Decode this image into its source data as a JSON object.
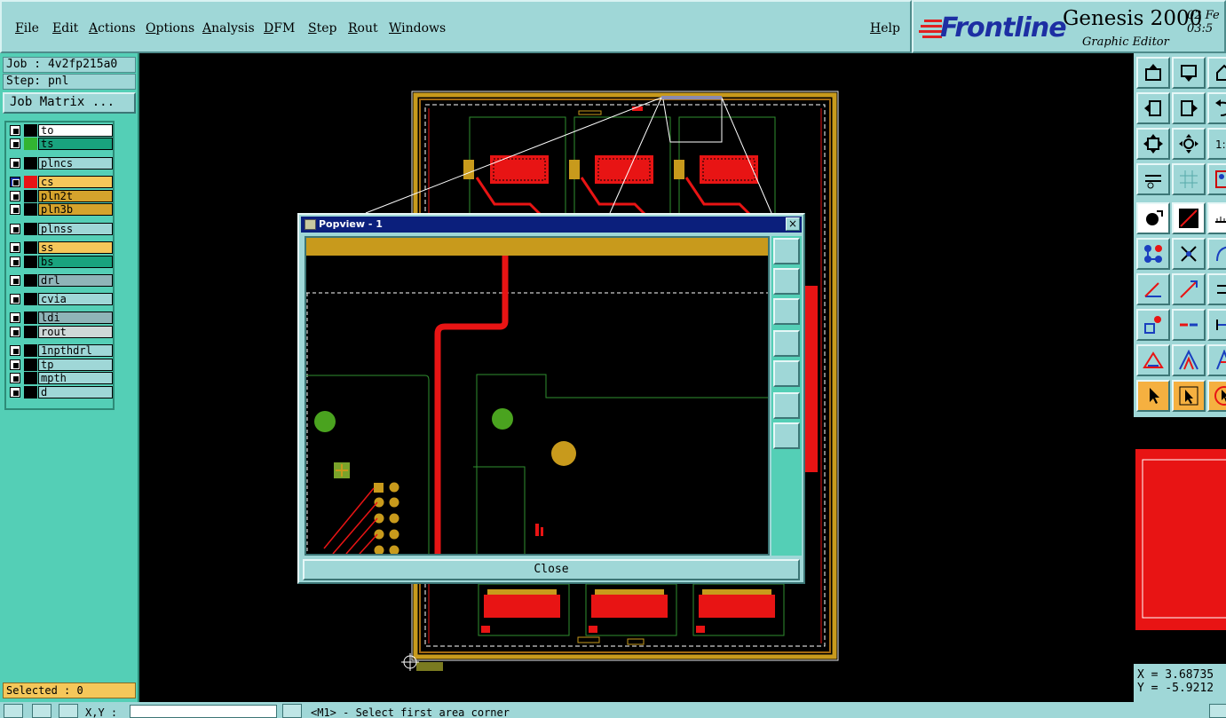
{
  "menu": {
    "items": [
      "File",
      "Edit",
      "Actions",
      "Options",
      "Analysis",
      "DFM",
      "Step",
      "Rout",
      "Windows"
    ],
    "help": "Help"
  },
  "logo": {
    "brand": "Frontline",
    "product": "Genesis 2000",
    "subtitle": "Graphic Editor",
    "date": "02 Fe",
    "time": "03:5"
  },
  "left": {
    "job": "Job : 4v2fp215a0",
    "step": "Step: pnl",
    "job_matrix": "Job Matrix ...",
    "layers": [
      {
        "name": "to",
        "color": "#ffffff",
        "swatch": "#000000"
      },
      {
        "name": "ts",
        "color": "#19a37e",
        "swatch": "#32b432"
      },
      {
        "name": "plncs",
        "color": "#9fd7d7",
        "swatch": "#000000"
      },
      {
        "name": "cs",
        "color": "#f5c75a",
        "swatch": "#e81414",
        "active": true
      },
      {
        "name": "pln2t",
        "color": "#d5a32c",
        "swatch": "#000000"
      },
      {
        "name": "pln3b",
        "color": "#d5a32c",
        "swatch": "#000000"
      },
      {
        "name": "plnss",
        "color": "#9fd7d7",
        "swatch": "#000000"
      },
      {
        "name": "ss",
        "color": "#f5c75a",
        "swatch": "#000000"
      },
      {
        "name": "bs",
        "color": "#19a37e",
        "swatch": "#000000"
      },
      {
        "name": "drl",
        "color": "#8fb4b8",
        "swatch": "#000000"
      },
      {
        "name": "cvia",
        "color": "#9fd7d7",
        "swatch": "#000000"
      },
      {
        "name": "ldi",
        "color": "#8fb4b8",
        "swatch": "#000000"
      },
      {
        "name": "rout",
        "color": "#cfd8d8",
        "swatch": "#000000"
      },
      {
        "name": "1npthdrl",
        "color": "#9fd7d7",
        "swatch": "#000000"
      },
      {
        "name": "tp",
        "color": "#9fd7d7",
        "swatch": "#000000"
      },
      {
        "name": "mpth",
        "color": "#9fd7d7",
        "swatch": "#000000"
      },
      {
        "name": "d",
        "color": "#9fd7d7",
        "swatch": "#000000"
      }
    ],
    "selected": "Selected : 0"
  },
  "popview": {
    "title": "Popview - 1",
    "close_x": "×",
    "close_button": "Close"
  },
  "coords": {
    "x": "X = 3.68735",
    "y": "Y = -5.9212"
  },
  "status": {
    "xy_label": "X,Y :",
    "prompt": "<M1> - Select first area corner"
  },
  "colors": {
    "panel": "#9fd7d7",
    "layer_panel": "#54cfb6",
    "trace": "#e81414",
    "copper": "#c89a1c",
    "outline": "#2f8f2f"
  }
}
